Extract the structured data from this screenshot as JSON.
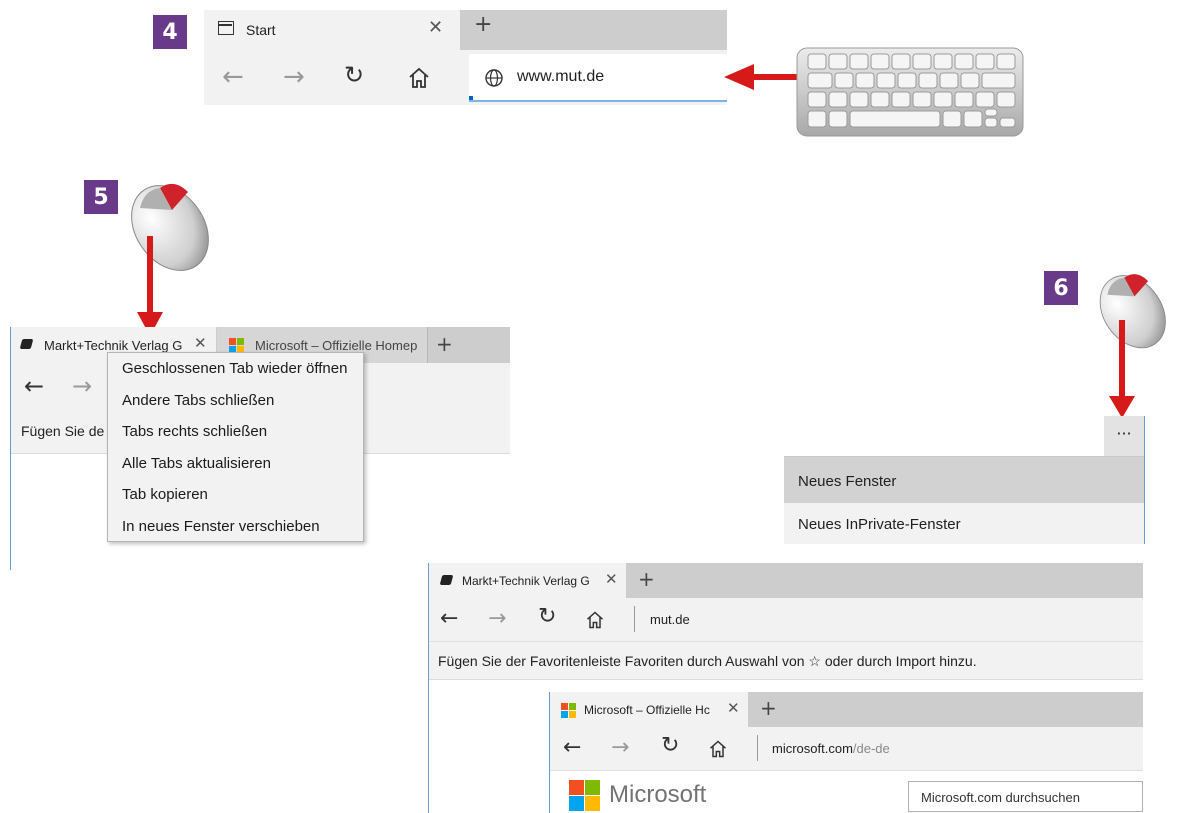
{
  "steps": {
    "s4": "4",
    "s5": "5",
    "s6": "6"
  },
  "colors": {
    "step_badge": "#6a3a8a",
    "arrow": "#d61a1a",
    "tabbar": "#cdcdcd",
    "chrome": "#f2f2f2"
  },
  "panel4": {
    "tab_title": "Start",
    "url": "www.mut.de",
    "icons": {
      "tab": "window-icon",
      "back": "back-arrow-icon",
      "forward": "forward-arrow-icon",
      "refresh": "refresh-icon",
      "home": "home-icon",
      "globe": "globe-icon",
      "keyboard": "keyboard-icon"
    }
  },
  "panel5": {
    "tab1_title": "Markt+Technik Verlag G",
    "tab2_title": "Microsoft – Offizielle Homep",
    "fav_prefix": "Fügen Sie de",
    "context_menu": [
      "Geschlossenen Tab wieder öffnen",
      "Andere Tabs schließen",
      "Tabs rechts schließen",
      "Alle Tabs aktualisieren",
      "Tab kopieren",
      "In neues Fenster verschieben"
    ]
  },
  "panel6": {
    "more_label": "···",
    "menu": [
      "Neues Fenster",
      "Neues InPrivate-Fenster"
    ]
  },
  "window_big": {
    "tab_title": "Markt+Technik Verlag G",
    "url": "mut.de",
    "favbar": "Fügen Sie der Favoritenleiste Favoriten durch Auswahl von ☆ oder durch Import hinzu."
  },
  "window_small": {
    "tab_title": "Microsoft – Offizielle Hc",
    "url_host": "microsoft.com",
    "url_path": "/de-de",
    "brand": "Microsoft",
    "search_placeholder": "Microsoft.com durchsuchen"
  }
}
